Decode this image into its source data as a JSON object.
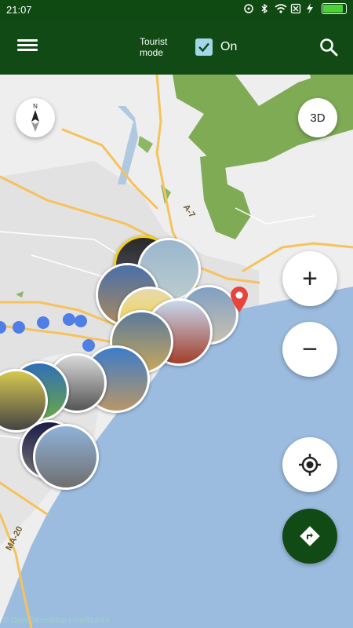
{
  "status_bar": {
    "time": "21:07"
  },
  "app_bar": {
    "tourist_mode_label": "Tourist mode",
    "toggle_value": "On",
    "tourist_mode_checked": true
  },
  "map": {
    "road_labels": [
      "A-7",
      "MA-20"
    ],
    "button_3d_label": "3D",
    "zoom_in_symbol": "+",
    "zoom_out_symbol": "−",
    "compass_north": "N",
    "copyright": "© OpenStreetMap contributors"
  },
  "colors": {
    "app_bar": "#114a14",
    "sea": "#9bbcdf",
    "park": "#7fab55",
    "roads": "#f6c25c"
  },
  "icons": [
    "menu-icon",
    "search-icon",
    "compass-icon",
    "locate-icon",
    "directions-icon",
    "map-pin-icon"
  ]
}
